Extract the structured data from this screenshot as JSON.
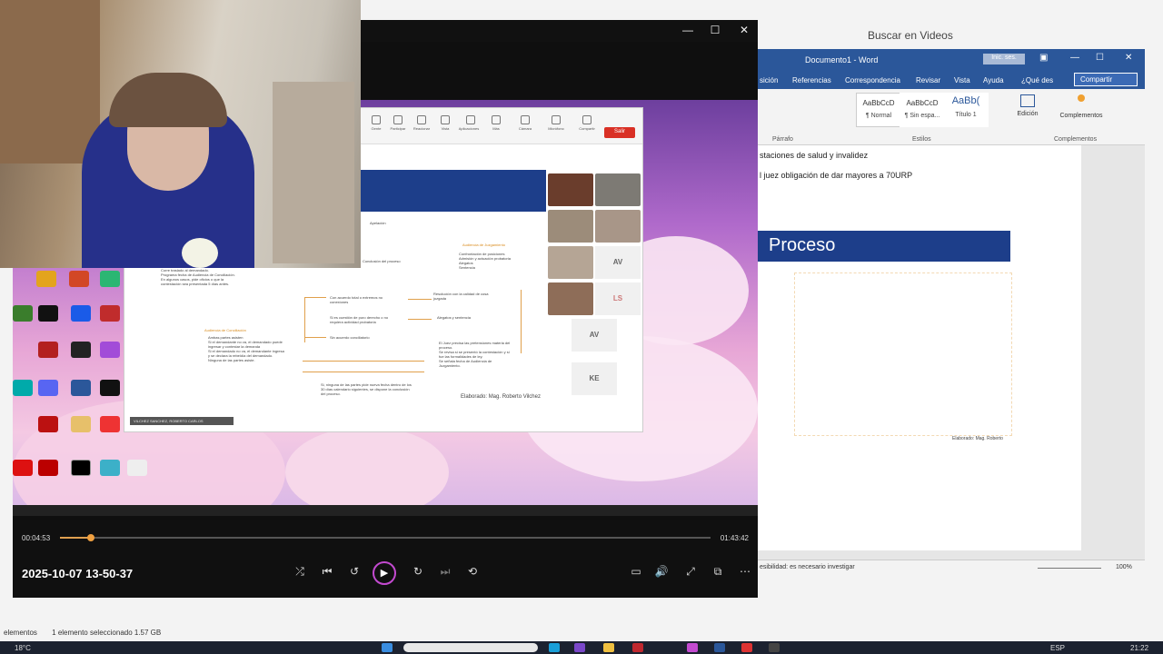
{
  "explorer": {
    "search_placeholder": "Buscar en Videos",
    "status_items": "elementos",
    "status_selected": "1 elemento seleccionado  1.57 GB"
  },
  "taskbar": {
    "temperature": "18°C",
    "language": "ESP",
    "time": "21:22"
  },
  "meeting": {
    "toolbar": [
      "Gente",
      "Participar",
      "Reacionar",
      "Vista",
      "Aplicaciones",
      "Más",
      "Cámara",
      "Micrófono",
      "Compartir"
    ],
    "leave_label": "Salir",
    "slide": {
      "apelacion": "Apelación",
      "audiencia_juzgamiento": "Audiencia de Juzgamiento",
      "items_right": [
        "Confrontación de posiciones",
        "Admisión y actuación probatoria",
        "Alegatos",
        "Sentencia"
      ],
      "conclusion": "Conclusión del proceso",
      "audiencia_conciliacion": "Audiencia de Conciliación",
      "items_left_top": [
        "Corre traslado al demandado.",
        "Programa fecha de Audiencia de Conciliación.",
        "En algunos casos, pide oficios o que la contestación sea presentada 5 días antes."
      ],
      "items_left": [
        "Ambas partes asisten",
        "Si el demandante no va, el demandado puede ingresar y contestar la demanda",
        "Si el demandado no va, el demandante ingresa y se declara la rebeldía del demandado.",
        "Ninguna de las partes asiste."
      ],
      "branch1": "Con acuerdo total o extremos no conexiones",
      "branch2": "Si es cuestión de puro derecho o no requiera actividad probatoria",
      "branch3": "Sin acuerdo conciliatorio",
      "result1": "Resolución con la calidad de cosa juzgada",
      "result2": "Alegatos y sentencia",
      "judge_items": [
        "El Juez precisa las pretensiones materia del proceso.",
        "Se revisa si se presentó la contestación y si fue las formalidades de ley.",
        "Se señala fecha de Audiencia de Juzgamiento."
      ],
      "footer_note": "Si, ninguna de las partes pide nueva fecha dentro de los 30 días calendario siguientes, se dispone la conclusión del proceso.",
      "author": "Elaborado: Mag. Roberto Vilchez"
    },
    "participants": [
      "AV",
      "LS",
      "AV",
      "KE"
    ],
    "presenter_name": "VILCHEZ SANCHEZ, ROBERTO CARLOS"
  },
  "player": {
    "current_time": "00:04:53",
    "total_time": "01:43:42",
    "progress": 0.047,
    "title": "2025-10-07 13-50-37",
    "accent_color": "#c34ad0"
  },
  "word": {
    "title": "Documento1 - Word",
    "sign_in": "Inic. ses.",
    "tabs": [
      "sición",
      "Referencias",
      "Correspondencia",
      "Revisar",
      "Vista",
      "Ayuda",
      "¿Qué des"
    ],
    "share_label": "Compartir",
    "styles": [
      {
        "preview": "AaBbCcD",
        "name": "¶ Normal"
      },
      {
        "preview": "AaBbCcD",
        "name": "¶ Sin espa..."
      },
      {
        "preview": "AaBb(",
        "name": "Título 1"
      }
    ],
    "edit_label": "Edición",
    "addins_label": "Complementos",
    "group_paragraph": "Párrafo",
    "group_styles": "Estilos",
    "group_addins": "Complementos",
    "doc_line1": "staciones de salud y invalidez",
    "doc_line2": "l juez obligación de dar mayores a 70URP",
    "doc_banner": "Proceso",
    "doc_author": "Elaborado: Mag. Roberto",
    "status_text": "esibilidad: es necesario investigar",
    "zoom": "100%"
  }
}
